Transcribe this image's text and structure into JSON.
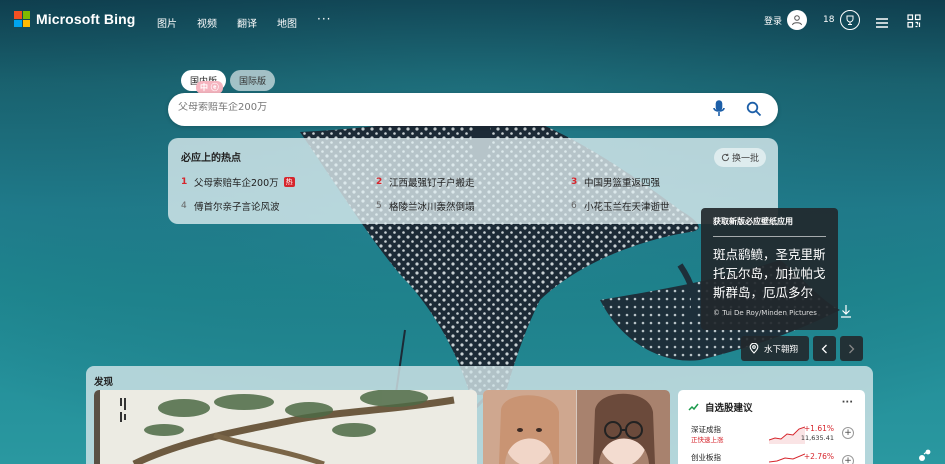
{
  "brand": {
    "name": "Microsoft Bing",
    "colors": [
      "#f25022",
      "#7fba00",
      "#00a4ef",
      "#ffb900"
    ]
  },
  "nav": {
    "items": [
      "图片",
      "视频",
      "翻译",
      "地图"
    ],
    "more": "···"
  },
  "account": {
    "login_label": "登录",
    "rewards_count": "18"
  },
  "search": {
    "tabs": [
      {
        "label": "国内版"
      },
      {
        "label": "国际版"
      }
    ],
    "tab_badge": "中 ⓔ",
    "placeholder": "父母索赔车企200万"
  },
  "trending": {
    "title": "必应上的热点",
    "refresh_label": "换一批",
    "hot_label": "热",
    "items": [
      {
        "rank": "1",
        "text": "父母索赔车企200万",
        "hot": true
      },
      {
        "rank": "2",
        "text": "江西最强钉子户搬走"
      },
      {
        "rank": "3",
        "text": "中国男篮重返四强"
      },
      {
        "rank": "4",
        "text": "傅首尔亲子言论风波"
      },
      {
        "rank": "5",
        "text": "格陵兰冰川轰然倒塌"
      },
      {
        "rank": "6",
        "text": "小花玉兰在天津逝世"
      }
    ]
  },
  "wallpaper": {
    "heading": "获取新版必应壁纸应用",
    "title": "斑点鹞鲼，圣克里斯托瓦尔岛，加拉帕戈斯群岛，厄瓜多尔",
    "credit": "© Tui De Roy/Minden Pictures",
    "tag_label": "水下翱翔"
  },
  "discover": {
    "title": "发现",
    "stocks": {
      "title": "自选股建议",
      "more": "···",
      "items": [
        {
          "name": "深证成指",
          "sub": "正快速上涨",
          "change": "+1.61%",
          "value": "11,635.41"
        },
        {
          "name": "创业板指",
          "sub": "",
          "change": "+2.76%",
          "value": ""
        }
      ]
    }
  }
}
